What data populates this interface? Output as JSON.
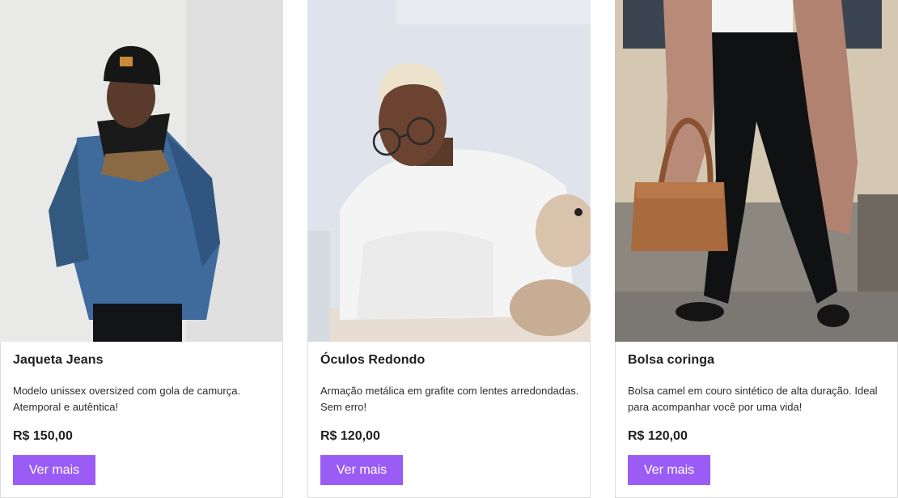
{
  "products": [
    {
      "title": "Jaqueta Jeans",
      "description": "Modelo unissex oversized com gola de camurça. Atemporal e autêntica!",
      "price": "R$ 150,00",
      "button_label": "Ver mais",
      "image": "man-in-denim-jacket-photo"
    },
    {
      "title": "Óculos Redondo",
      "description": "Armação metálica em grafite com lentes arredondadas. Sem erro!",
      "price": "R$ 120,00",
      "button_label": "Ver mais",
      "image": "man-with-round-glasses-photo"
    },
    {
      "title": "Bolsa coringa",
      "description": "Bolsa camel em couro sintético de alta duração. Ideal para acompanhar você por uma vida!",
      "price": "R$ 120,00",
      "button_label": "Ver mais",
      "image": "woman-with-camel-bag-photo"
    }
  ],
  "colors": {
    "button": "#9b5cf6",
    "button_text": "#ffffff",
    "text": "#1f1f1f",
    "border": "#dcdcdc"
  }
}
